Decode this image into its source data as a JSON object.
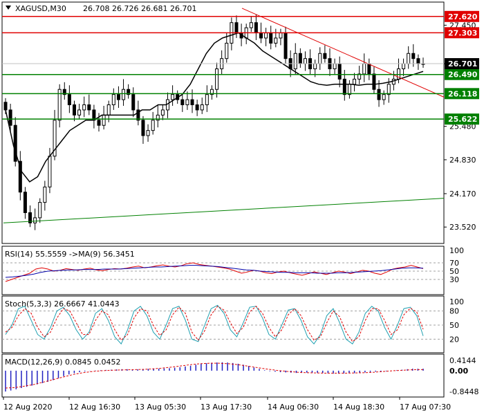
{
  "header": {
    "symbol": "XAGUSD,M30",
    "ohlc": "26.708 26.726 26.681 26.701"
  },
  "colors": {
    "bull": "#000000",
    "bear": "#000000",
    "ma": "#000000",
    "resistance": "#e00000",
    "support": "#008000",
    "trend_down": "#e00000",
    "trend_up": "#008000",
    "rsi": "#e00000",
    "rsi_ma": "#0000aa",
    "stoch_main": "#1e9fb0",
    "stoch_signal": "#e00000",
    "macd_hist": "#2020c0",
    "macd_signal": "#e00000"
  },
  "chart_data": [
    {
      "type": "candlestick",
      "ylim": [
        23.2,
        27.9
      ],
      "y_ticks": [
        23.52,
        24.17,
        24.83,
        25.48,
        26.7,
        27.45
      ],
      "x_labels": [
        "12 Aug 2020",
        "12 Aug 16:30",
        "13 Aug 05:30",
        "13 Aug 17:30",
        "14 Aug 06:30",
        "14 Aug 18:30",
        "17 Aug 07:30"
      ],
      "close_series": [
        25.8,
        25.5,
        24.8,
        24.2,
        23.8,
        23.6,
        23.7,
        24.0,
        24.3,
        24.9,
        25.6,
        26.2,
        26.1,
        25.9,
        25.7,
        25.8,
        25.9,
        25.8,
        25.6,
        25.5,
        25.7,
        25.9,
        26.1,
        26.0,
        26.2,
        26.1,
        25.8,
        25.6,
        25.3,
        25.4,
        25.6,
        25.7,
        25.8,
        26.0,
        26.1,
        26.0,
        25.9,
        26.0,
        25.9,
        25.8,
        25.9,
        26.1,
        26.2,
        26.6,
        26.8,
        27.1,
        27.5,
        27.3,
        27.2,
        27.4,
        27.5,
        27.3,
        27.2,
        27.3,
        27.1,
        27.2,
        27.3,
        26.8,
        26.6,
        26.9,
        26.7,
        26.8,
        26.6,
        26.7,
        26.9,
        26.8,
        26.6,
        26.7,
        26.4,
        26.1,
        26.3,
        26.4,
        26.5,
        26.7,
        26.5,
        26.2,
        26.0,
        26.1,
        26.3,
        26.4,
        26.6,
        26.7,
        26.9,
        26.8,
        26.7,
        26.7
      ],
      "ma_series": [
        25.8,
        25.1,
        24.6,
        24.4,
        24.5,
        24.8,
        25.0,
        25.2,
        25.4,
        25.5,
        25.6,
        25.6,
        25.7,
        25.7,
        25.7,
        25.7,
        25.7,
        25.8,
        25.8,
        25.9,
        25.9,
        26.0,
        26.1,
        26.3,
        26.6,
        26.9,
        27.1,
        27.2,
        27.25,
        27.3,
        27.2,
        27.1,
        26.95,
        26.85,
        26.75,
        26.65,
        26.55,
        26.45,
        26.35,
        26.3,
        26.28,
        26.3,
        26.3,
        26.3,
        26.28,
        26.3,
        26.3,
        26.32,
        26.35,
        26.4,
        26.45,
        26.5,
        26.55
      ],
      "levels": [
        {
          "label": "27.620",
          "value": 27.62,
          "kind": "resistance"
        },
        {
          "label": "27.303",
          "value": 27.303,
          "kind": "resistance"
        },
        {
          "label": "26.490",
          "value": 26.49,
          "kind": "support"
        },
        {
          "label": "26.118",
          "value": 26.118,
          "kind": "support"
        },
        {
          "label": "25.622",
          "value": 25.622,
          "kind": "support"
        }
      ],
      "current_price": {
        "label": "26.701",
        "value": 26.701
      }
    },
    {
      "type": "line",
      "title": "RSI(14) 55.5559 ->MA(9) 56.3451",
      "ylim": [
        0,
        100
      ],
      "y_ticks": [
        30,
        50,
        70,
        100
      ],
      "levels": [
        30,
        50,
        70
      ],
      "rsi": [
        25,
        30,
        35,
        40,
        45,
        55,
        58,
        55,
        50,
        52,
        56,
        54,
        52,
        55,
        57,
        53,
        51,
        54,
        56,
        55,
        57,
        60,
        62,
        58,
        60,
        63,
        65,
        62,
        60,
        63,
        68,
        70,
        66,
        64,
        62,
        60,
        58,
        55,
        50,
        45,
        48,
        52,
        50,
        46,
        44,
        48,
        50,
        46,
        43,
        40,
        44,
        48,
        45,
        42,
        46,
        50,
        48,
        44,
        48,
        52,
        50,
        45,
        42,
        48,
        55,
        58,
        60,
        64,
        60,
        56
      ],
      "rsi_ma": [
        35,
        36,
        38,
        40,
        43,
        47,
        50,
        51,
        52,
        53,
        53,
        54,
        54,
        54,
        55,
        55,
        55,
        56,
        57,
        58,
        59,
        60,
        60,
        61,
        62,
        63,
        64,
        64,
        63,
        62,
        61,
        59,
        57,
        55,
        53,
        52,
        50,
        49,
        48,
        47,
        47,
        46,
        46,
        46,
        45,
        45,
        45,
        46,
        46,
        47,
        48,
        49,
        50,
        51,
        53,
        55,
        57,
        58,
        58,
        57
      ]
    },
    {
      "type": "line",
      "title": "Stoch(5,3,3) 26.6667 41.0443",
      "ylim": [
        0,
        100
      ],
      "y_ticks": [
        20,
        50,
        80,
        100
      ],
      "levels": [
        20,
        50,
        80
      ],
      "main": [
        30,
        50,
        85,
        90,
        60,
        30,
        20,
        45,
        80,
        88,
        70,
        40,
        20,
        35,
        75,
        85,
        60,
        25,
        10,
        40,
        80,
        90,
        70,
        35,
        20,
        50,
        85,
        90,
        60,
        20,
        15,
        50,
        85,
        92,
        75,
        40,
        25,
        55,
        88,
        90,
        65,
        30,
        20,
        50,
        82,
        85,
        60,
        25,
        10,
        30,
        70,
        85,
        55,
        20,
        10,
        35,
        75,
        90,
        80,
        45,
        20,
        50,
        85,
        88,
        70,
        27
      ],
      "signal": [
        35,
        45,
        70,
        85,
        75,
        45,
        25,
        35,
        65,
        85,
        80,
        55,
        30,
        30,
        60,
        80,
        72,
        40,
        18,
        30,
        65,
        85,
        80,
        50,
        28,
        40,
        72,
        88,
        75,
        35,
        18,
        38,
        72,
        90,
        82,
        55,
        32,
        45,
        78,
        90,
        75,
        45,
        25,
        40,
        72,
        85,
        70,
        40,
        18,
        25,
        55,
        80,
        68,
        35,
        15,
        25,
        60,
        85,
        85,
        60,
        30,
        40,
        72,
        86,
        78,
        41
      ]
    },
    {
      "type": "bar",
      "title": "MACD(12,26,9) 0.0845 0.0452",
      "y_ticks": [
        0.4144,
        0.0,
        -0.8448
      ],
      "ylim": [
        -0.95,
        0.5
      ],
      "histogram": [
        -0.84,
        -0.8,
        -0.75,
        -0.7,
        -0.65,
        -0.6,
        -0.55,
        -0.5,
        -0.45,
        -0.38,
        -0.3,
        -0.22,
        -0.15,
        -0.1,
        -0.06,
        -0.03,
        -0.01,
        0.01,
        0.02,
        0.03,
        0.04,
        0.05,
        0.06,
        0.06,
        0.05,
        0.05,
        0.06,
        0.07,
        0.07,
        0.08,
        0.09,
        0.1,
        0.12,
        0.14,
        0.17,
        0.2,
        0.24,
        0.28,
        0.3,
        0.32,
        0.33,
        0.34,
        0.33,
        0.31,
        0.28,
        0.24,
        0.19,
        0.13,
        0.07,
        0.02,
        -0.02,
        -0.04,
        -0.06,
        -0.07,
        -0.08,
        -0.09,
        -0.09,
        -0.08,
        -0.08,
        -0.09,
        -0.1,
        -0.11,
        -0.12,
        -0.12,
        -0.11,
        -0.1,
        -0.1,
        -0.09,
        -0.07,
        -0.05,
        -0.04,
        -0.03,
        -0.02,
        0.0,
        0.02,
        0.04,
        0.06,
        0.08,
        0.08,
        0.08
      ],
      "signal": [
        -0.7,
        -0.68,
        -0.62,
        -0.55,
        -0.45,
        -0.35,
        -0.25,
        -0.15,
        -0.08,
        -0.03,
        0.0,
        0.02,
        0.03,
        0.04,
        0.05,
        0.07,
        0.1,
        0.14,
        0.19,
        0.24,
        0.28,
        0.3,
        0.3,
        0.28,
        0.24,
        0.18,
        0.12,
        0.06,
        0.01,
        -0.03,
        -0.06,
        -0.08,
        -0.09,
        -0.1,
        -0.1,
        -0.1,
        -0.09,
        -0.08,
        -0.06,
        -0.03,
        0.0,
        0.02,
        0.04,
        0.045
      ]
    }
  ]
}
